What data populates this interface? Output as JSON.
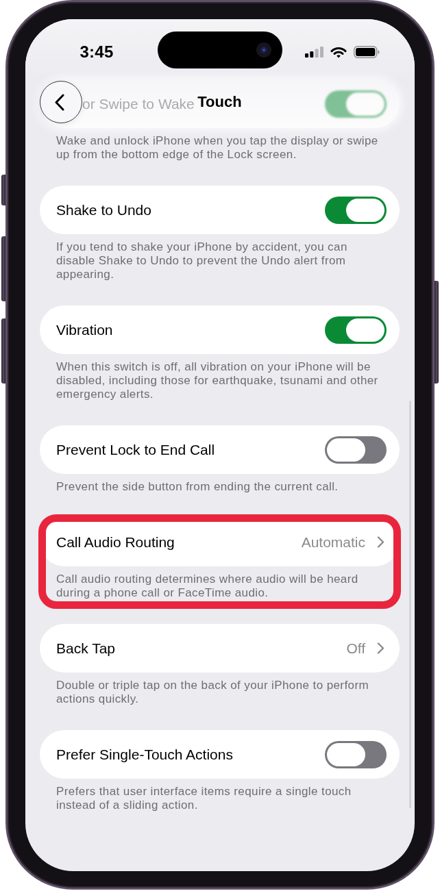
{
  "status_bar": {
    "time": "3:45"
  },
  "nav": {
    "title": "Touch"
  },
  "rows": [
    {
      "kind": "toggle",
      "label": "or Swipe to Wake",
      "on": true,
      "obscured": true,
      "highlighted": false,
      "description": "Wake and unlock iPhone when you tap the display or swipe up from the bottom edge of the Lock screen."
    },
    {
      "kind": "toggle",
      "label": "Shake to Undo",
      "on": true,
      "obscured": false,
      "highlighted": false,
      "description": "If you tend to shake your iPhone by accident, you can disable Shake to Undo to prevent the Undo alert from appearing."
    },
    {
      "kind": "toggle",
      "label": "Vibration",
      "on": true,
      "obscured": false,
      "highlighted": false,
      "description": "When this switch is off, all vibration on your iPhone will be disabled, including those for earthquake, tsunami and other emergency alerts."
    },
    {
      "kind": "toggle",
      "label": "Prevent Lock to End Call",
      "on": false,
      "obscured": false,
      "highlighted": false,
      "description": "Prevent the side button from ending the current call."
    },
    {
      "kind": "link",
      "label": "Call Audio Routing",
      "value": "Automatic",
      "obscured": false,
      "highlighted": true,
      "description": "Call audio routing determines where audio will be heard during a phone call or FaceTime audio."
    },
    {
      "kind": "link",
      "label": "Back Tap",
      "value": "Off",
      "obscured": false,
      "highlighted": false,
      "description": "Double or triple tap on the back of your iPhone to perform actions quickly."
    },
    {
      "kind": "toggle",
      "label": "Prefer Single-Touch Actions",
      "on": false,
      "obscured": false,
      "highlighted": false,
      "description": "Prefers that user interface items require a single touch instead of a sliding action."
    }
  ]
}
